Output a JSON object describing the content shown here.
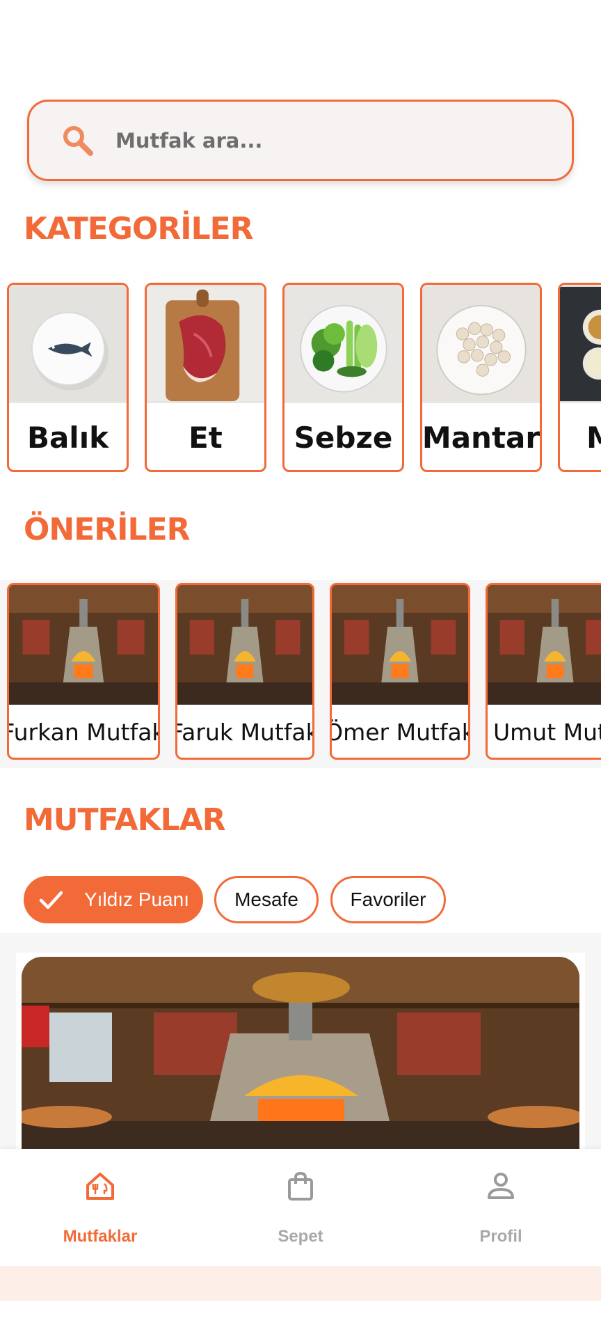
{
  "search": {
    "placeholder": "Mutfak ara..."
  },
  "sections": {
    "categories_title": "KATEGORİLER",
    "suggestions_title": "ÖNERİLER",
    "kitchens_title": "MUTFAKLAR"
  },
  "categories": [
    {
      "label": "Balık",
      "image": "fish-on-plate"
    },
    {
      "label": "Et",
      "image": "steak-on-board"
    },
    {
      "label": "Sebze",
      "image": "vegetables-on-plate"
    },
    {
      "label": "Mantar",
      "image": "mushrooms-on-plate"
    },
    {
      "label": "M",
      "image": "sauces-platter"
    }
  ],
  "suggestions": [
    {
      "label": "Furkan Mutfak",
      "image": "wood-oven-restaurant"
    },
    {
      "label": "Faruk Mutfak",
      "image": "wood-oven-restaurant"
    },
    {
      "label": "Ömer Mutfak",
      "image": "wood-oven-restaurant"
    },
    {
      "label": "Umut Mutfak",
      "image": "wood-oven-restaurant"
    }
  ],
  "filters": [
    {
      "label": "Yıldız Puanı",
      "active": true,
      "icon": "check-icon"
    },
    {
      "label": "Mesafe",
      "active": false
    },
    {
      "label": "Favoriler",
      "active": false
    }
  ],
  "kitchen_card": {
    "image": "wood-oven-restaurant"
  },
  "bottom_nav": [
    {
      "label": "Mutfaklar",
      "icon": "restaurant-home-icon",
      "active": true
    },
    {
      "label": "Sepet",
      "icon": "shopping-bag-icon",
      "active": false
    },
    {
      "label": "Profil",
      "icon": "person-icon",
      "active": false
    }
  ],
  "colors": {
    "accent": "#f26a38",
    "inactive_nav": "#a9a9a9",
    "search_bg": "#f6f3f2",
    "bottom_band": "#fdeee8"
  }
}
